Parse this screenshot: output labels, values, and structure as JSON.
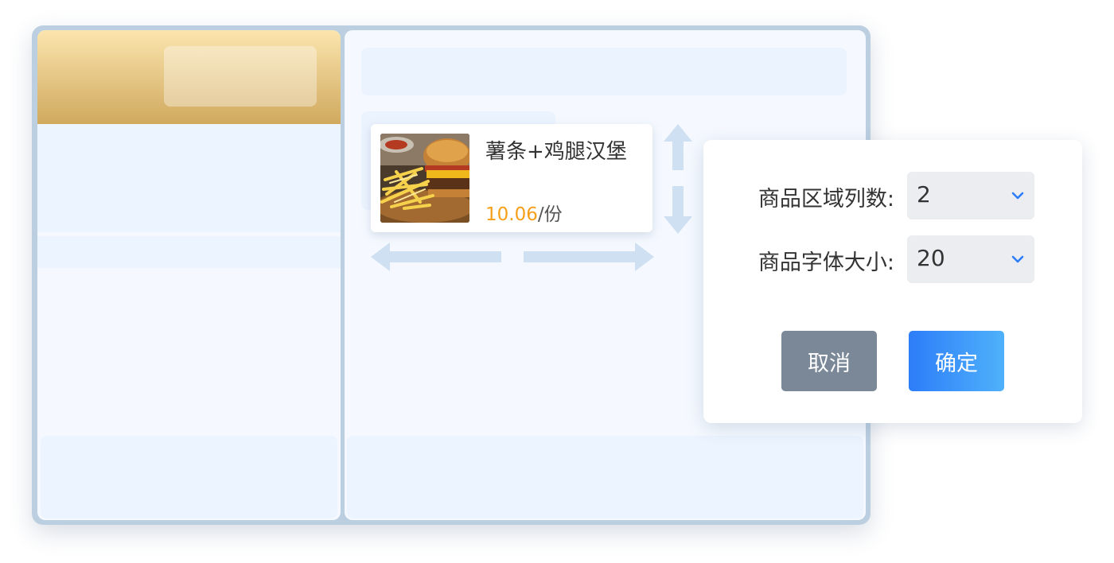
{
  "product": {
    "name": "薯条+鸡腿汉堡",
    "price": "10.06",
    "unit": "/份",
    "image_icon": "fries-burger-photo"
  },
  "dialog": {
    "fields": [
      {
        "label": "商品区域列数:",
        "value": "2"
      },
      {
        "label": "商品字体大小:",
        "value": "20"
      }
    ],
    "cancel_label": "取消",
    "confirm_label": "确定"
  },
  "colors": {
    "price": "#f5a01a",
    "confirm_button": "#2d7df9",
    "cancel_button": "#7a8898",
    "chevron": "#2d7df9",
    "arrows": "#cfe0f3"
  }
}
